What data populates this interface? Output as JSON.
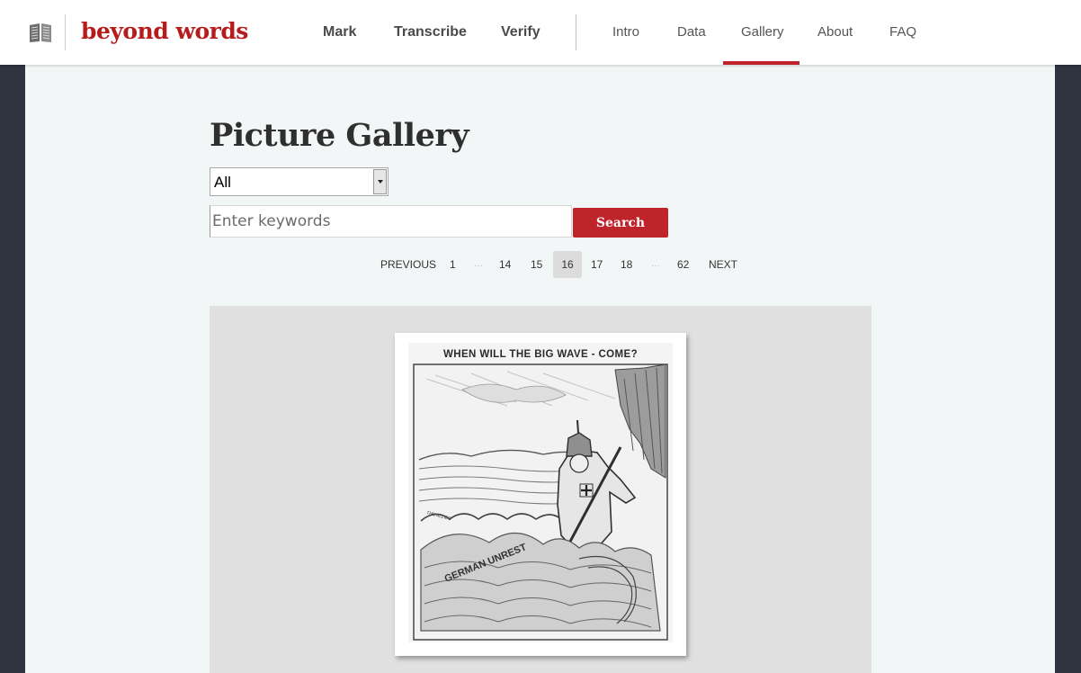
{
  "brand": {
    "name": "beyond words",
    "icon": "book-icon"
  },
  "nav": {
    "primary": [
      "Mark",
      "Transcribe",
      "Verify"
    ],
    "secondary": [
      "Intro",
      "Data",
      "Gallery",
      "About",
      "FAQ"
    ],
    "active": "Gallery"
  },
  "page": {
    "title": "Picture Gallery"
  },
  "filter": {
    "selected": "All"
  },
  "search": {
    "placeholder": "Enter keywords",
    "value": "",
    "button_label": "Search"
  },
  "pagination": {
    "previous_label": "PREVIOUS",
    "next_label": "NEXT",
    "items": [
      "1",
      "…",
      "14",
      "15",
      "16",
      "17",
      "18",
      "…",
      "62"
    ],
    "current": "16"
  },
  "gallery": {
    "items": [
      {
        "caption": "WHEN WILL THE BIG WAVE - COME?",
        "labels": [
          "THE ALLIES",
          "GERMAN UNREST"
        ]
      }
    ]
  },
  "colors": {
    "brand_red": "#c0242b",
    "header_bg": "#ffffff",
    "main_bg": "#f3f6f6",
    "frame_bg": "#2e3440"
  }
}
